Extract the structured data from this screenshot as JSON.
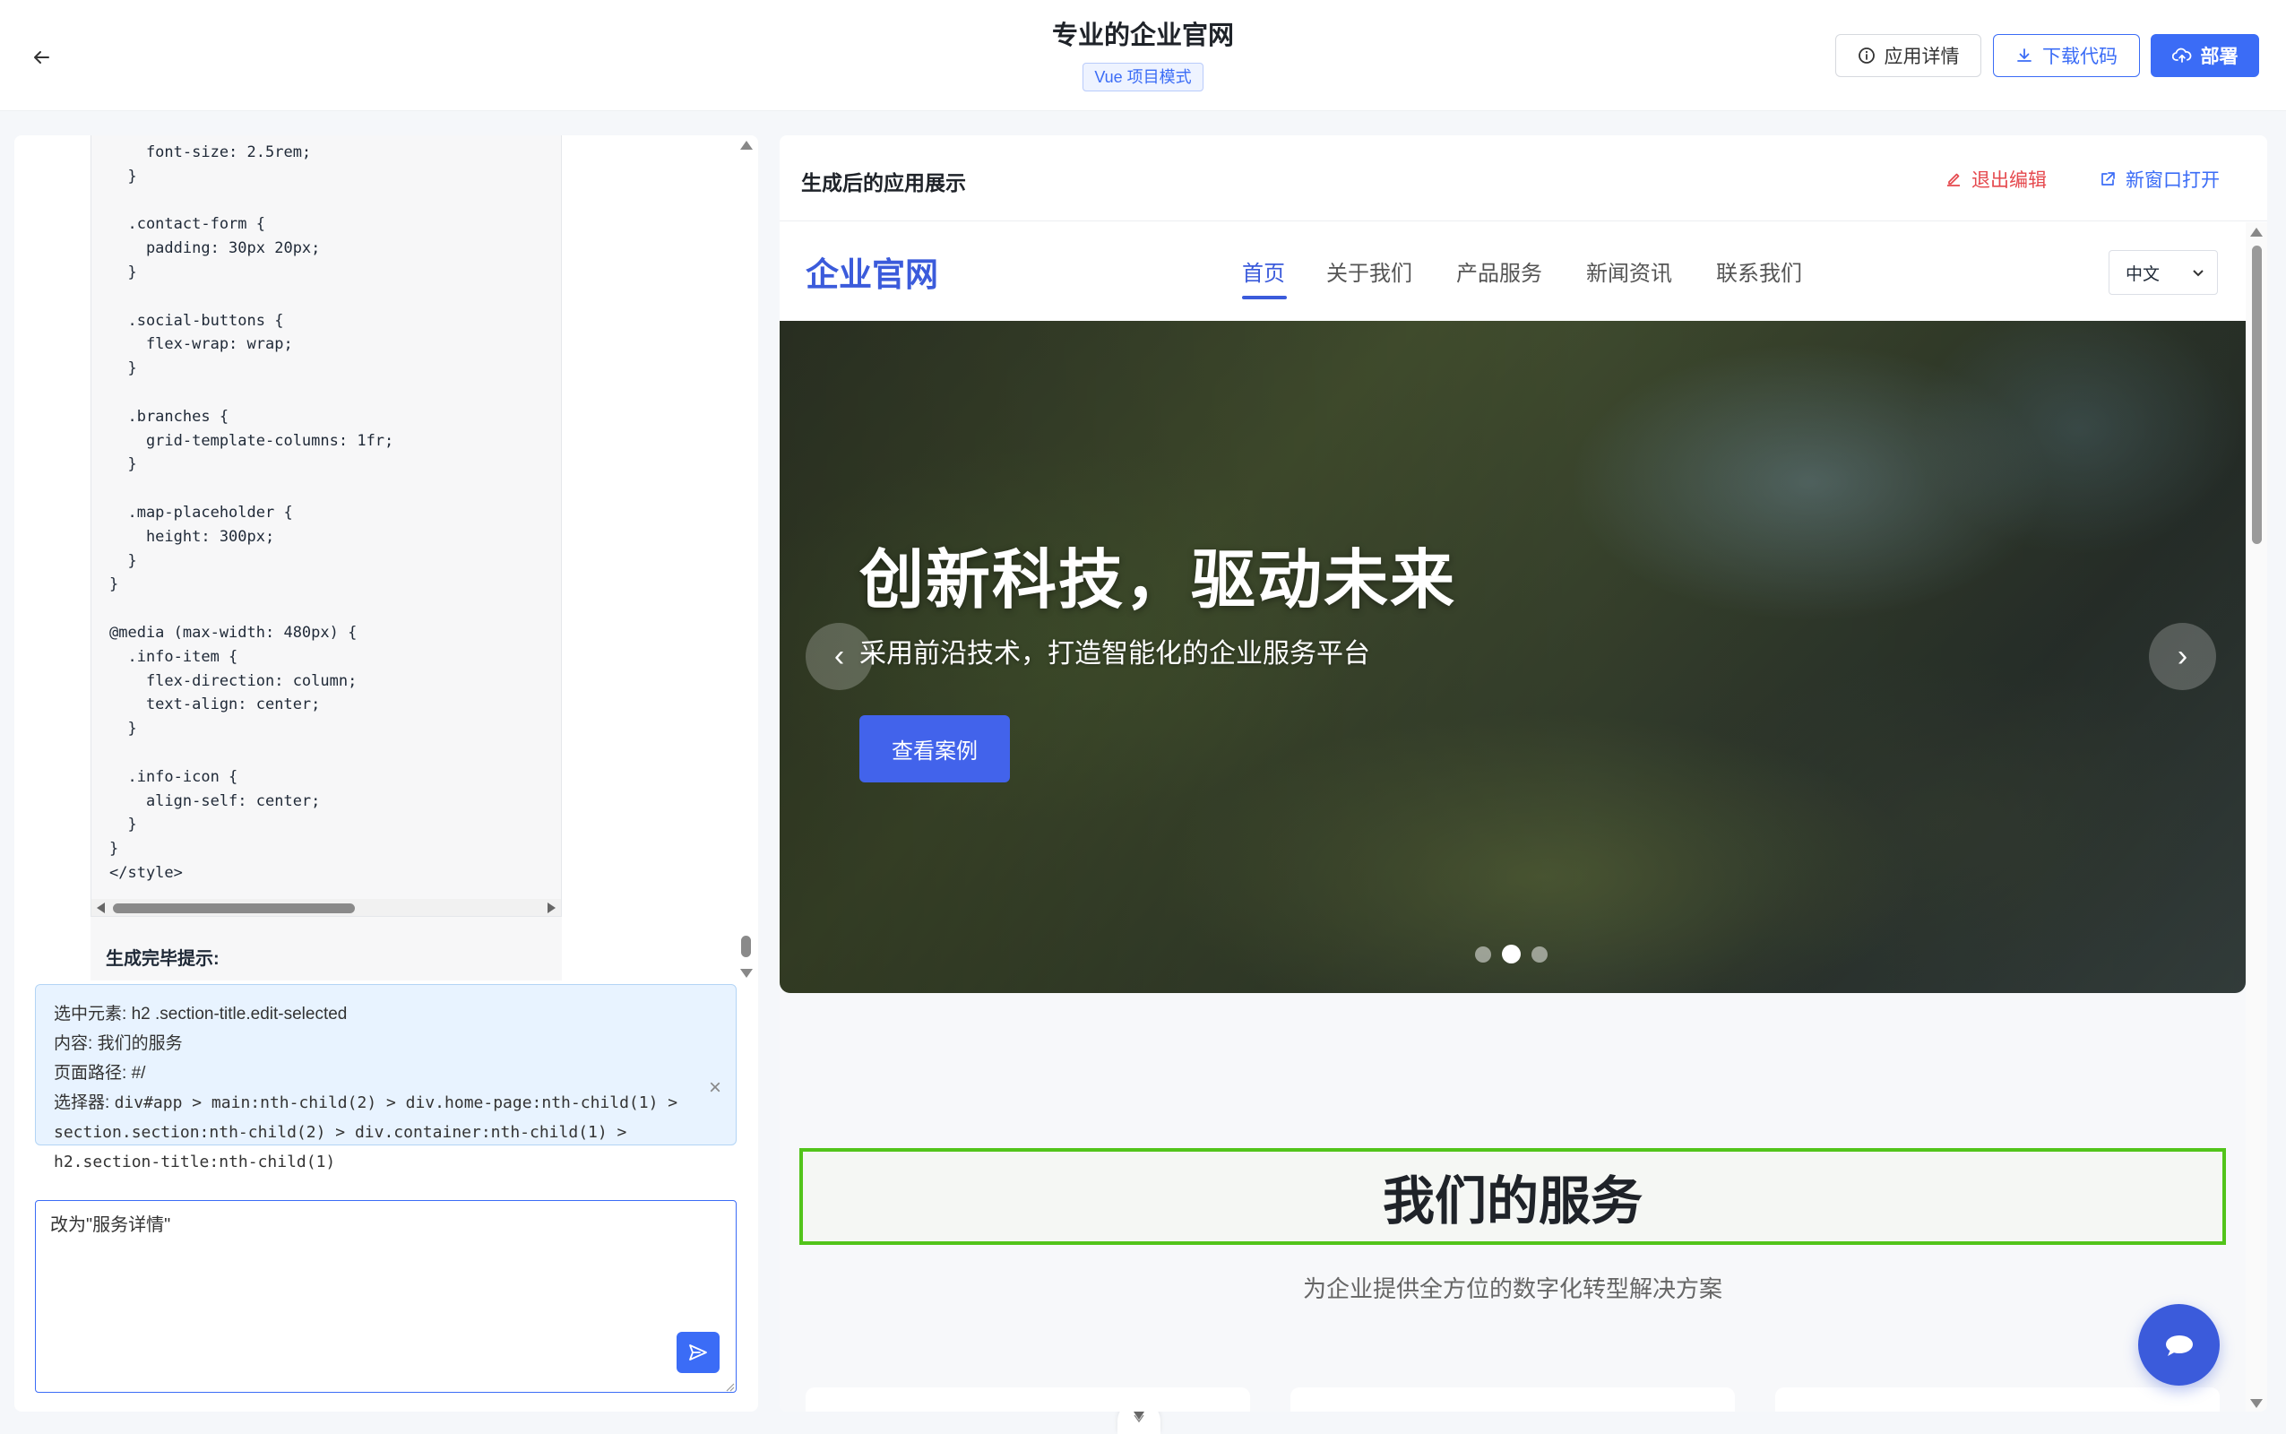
{
  "header": {
    "title": "专业的企业官网",
    "mode_badge": "Vue 项目模式",
    "buttons": {
      "details": "应用详情",
      "download": "下载代码",
      "deploy": "部署"
    }
  },
  "code_panel": {
    "code": "    font-size: 2.5rem;\n  }\n\n  .contact-form {\n    padding: 30px 20px;\n  }\n\n  .social-buttons {\n    flex-wrap: wrap;\n  }\n\n  .branches {\n    grid-template-columns: 1fr;\n  }\n\n  .map-placeholder {\n    height: 300px;\n  }\n}\n\n@media (max-width: 480px) {\n  .info-item {\n    flex-direction: column;\n    text-align: center;\n  }\n\n  .info-icon {\n    align-self: center;\n  }\n}\n</style>",
    "done_label": "生成完毕提示:"
  },
  "selection": {
    "element_label": "选中元素:",
    "element_value": "h2 .section-title.edit-selected",
    "content_label": "内容:",
    "content_value": "我们的服务",
    "path_label": "页面路径:",
    "path_value": "#/",
    "selector_label": "选择器:",
    "selector_value": "div#app > main:nth-child(2) > div.home-page:nth-child(1) > section.section:nth-child(2) > div.container:nth-child(1) > h2.section-title:nth-child(1)"
  },
  "chat": {
    "input_value": "改为\"服务详情\""
  },
  "preview_panel": {
    "title": "生成后的应用展示",
    "exit_edit": "退出编辑",
    "open_new": "新窗口打开"
  },
  "site": {
    "logo": "企业官网",
    "nav": [
      "首页",
      "关于我们",
      "产品服务",
      "新闻资讯",
      "联系我们"
    ],
    "active_nav": "首页",
    "language": "中文",
    "hero": {
      "title": "创新科技，驱动未来",
      "subtitle": "采用前沿技术，打造智能化的企业服务平台",
      "cta": "查看案例",
      "prev": "‹",
      "next": "›",
      "slide_count": 3,
      "active_slide": 2
    },
    "services": {
      "title": "我们的服务",
      "subtitle": "为企业提供全方位的数字化转型解决方案"
    }
  },
  "colors": {
    "primary": "#3b6cf6",
    "site_brand": "#3b5bdb",
    "danger": "#e5484d",
    "selected_outline": "#52c41a"
  }
}
